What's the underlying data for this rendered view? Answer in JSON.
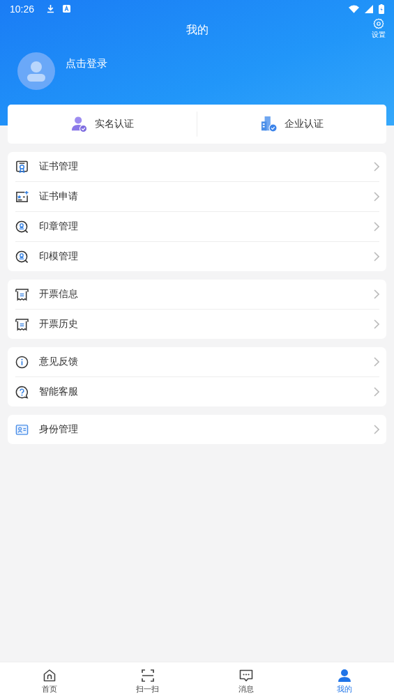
{
  "status_bar": {
    "time": "10:26"
  },
  "header": {
    "title": "我的",
    "settings_label": "设置"
  },
  "login": {
    "label": "点击登录"
  },
  "verify": [
    {
      "label": "实名认证",
      "kind": "person"
    },
    {
      "label": "企业认证",
      "kind": "company"
    }
  ],
  "groups": [
    {
      "items": [
        {
          "label": "证书管理",
          "kind": "certificate"
        },
        {
          "label": "证书申请",
          "kind": "apply"
        },
        {
          "label": "印章管理",
          "kind": "seal"
        },
        {
          "label": "印模管理",
          "kind": "seal"
        }
      ]
    },
    {
      "items": [
        {
          "label": "开票信息",
          "kind": "invoice"
        },
        {
          "label": "开票历史",
          "kind": "invoice"
        }
      ]
    },
    {
      "items": [
        {
          "label": "意见反馈",
          "kind": "info"
        },
        {
          "label": "智能客服",
          "kind": "help"
        }
      ]
    },
    {
      "items": [
        {
          "label": "身份管理",
          "kind": "id"
        }
      ]
    }
  ],
  "tabs": [
    {
      "label": "首页",
      "kind": "home",
      "selected": false
    },
    {
      "label": "扫一扫",
      "kind": "scan",
      "selected": false
    },
    {
      "label": "消息",
      "kind": "message",
      "selected": false
    },
    {
      "label": "我的",
      "kind": "person",
      "selected": true
    }
  ]
}
